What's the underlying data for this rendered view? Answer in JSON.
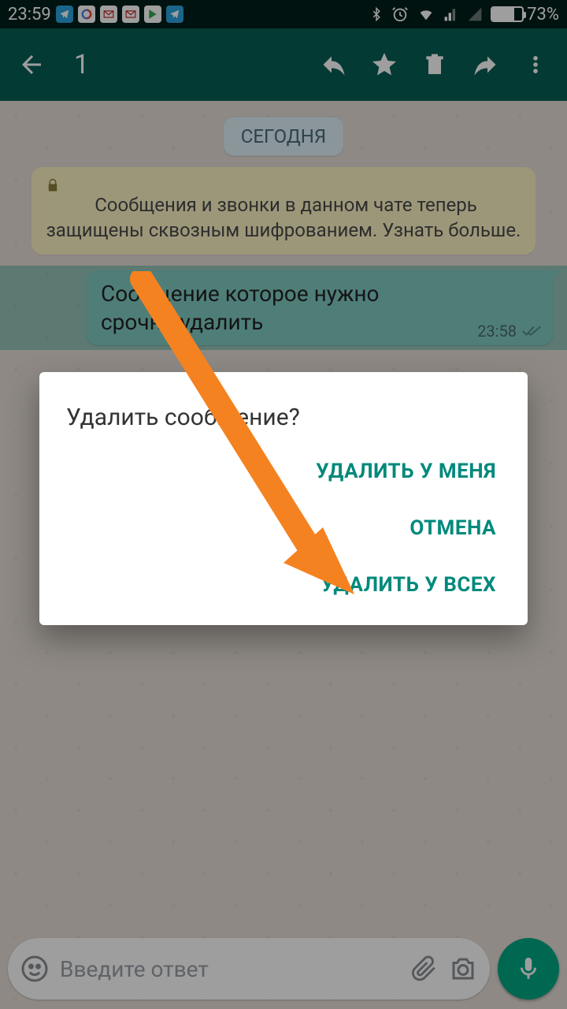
{
  "status": {
    "time": "23:59",
    "battery_pct": "73%",
    "battery_fill_pct": 73
  },
  "appbar": {
    "selection_count": "1"
  },
  "chat": {
    "date_label": "СЕГОДНЯ",
    "encryption_notice": "Сообщения и звонки в данном чате теперь защищены сквозным шифрованием. Узнать больше.",
    "message": {
      "text": "Сообщение которое нужно срочно удалить",
      "time": "23:58"
    }
  },
  "input": {
    "placeholder": "Введите ответ"
  },
  "dialog": {
    "title": "Удалить сообщение?",
    "delete_for_me": "УДАЛИТЬ У МЕНЯ",
    "cancel": "ОТМЕНА",
    "delete_for_everyone": "УДАЛИТЬ У ВСЕХ"
  }
}
